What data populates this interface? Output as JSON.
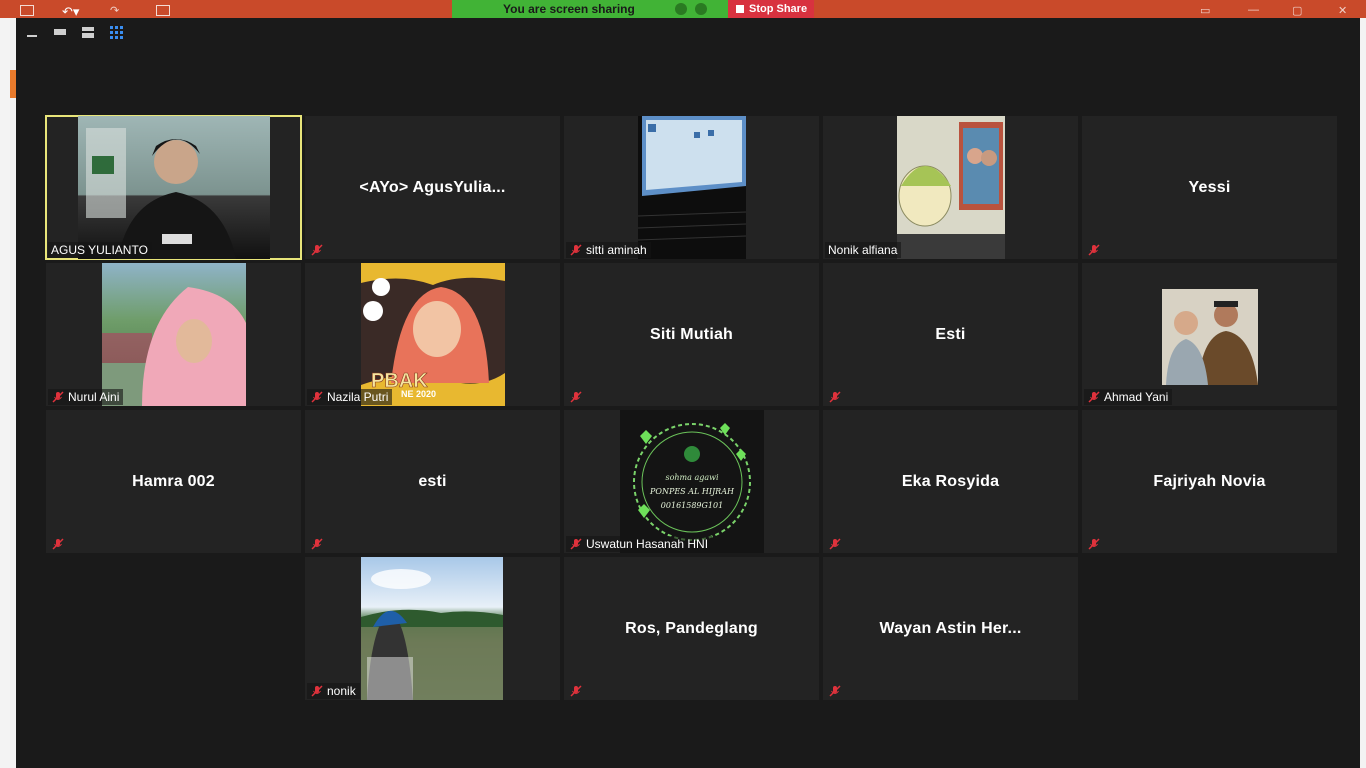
{
  "banner": {
    "text": "You are screen sharing",
    "stop_label": "Stop Share"
  },
  "colors": {
    "banner_green": "#41b336",
    "stop_red": "#d8323f",
    "active_border": "#e8e57a",
    "muted_mic": "#e0323c"
  },
  "participants": [
    {
      "name": "AGUS YULIANTO",
      "center_name": "",
      "video": true,
      "active": true,
      "muted": false
    },
    {
      "name": "",
      "center_name": "<AYo> AgusYulia...",
      "video": false,
      "active": false,
      "muted": true
    },
    {
      "name": "sitti aminah",
      "center_name": "",
      "video": true,
      "active": false,
      "muted": true
    },
    {
      "name": "Nonik alfiana",
      "center_name": "",
      "video": true,
      "active": false,
      "muted": false
    },
    {
      "name": "",
      "center_name": "Yessi",
      "video": false,
      "active": false,
      "muted": true
    },
    {
      "name": "Nurul Aini",
      "center_name": "",
      "video": true,
      "active": false,
      "muted": true
    },
    {
      "name": "Nazila Putri",
      "center_name": "",
      "video": true,
      "active": false,
      "muted": true
    },
    {
      "name": "",
      "center_name": "Siti Mutiah",
      "video": false,
      "active": false,
      "muted": true
    },
    {
      "name": "",
      "center_name": "Esti",
      "video": false,
      "active": false,
      "muted": true
    },
    {
      "name": "Ahmad Yani",
      "center_name": "",
      "video": true,
      "active": false,
      "muted": true
    },
    {
      "name": "",
      "center_name": "Hamra 002",
      "video": false,
      "active": false,
      "muted": true
    },
    {
      "name": "",
      "center_name": "esti",
      "video": false,
      "active": false,
      "muted": true
    },
    {
      "name": "Uswatun Hasanah HNI",
      "center_name": "",
      "video": true,
      "active": false,
      "muted": true
    },
    {
      "name": "",
      "center_name": "Eka Rosyida",
      "video": false,
      "active": false,
      "muted": true
    },
    {
      "name": "",
      "center_name": "Fajriyah Novia",
      "video": false,
      "active": false,
      "muted": true
    },
    {
      "name": "nonik",
      "center_name": "",
      "video": true,
      "active": false,
      "muted": true
    },
    {
      "name": "",
      "center_name": "Ros, Pandeglang",
      "video": false,
      "active": false,
      "muted": true
    },
    {
      "name": "",
      "center_name": "Wayan Astin Her...",
      "video": false,
      "active": false,
      "muted": true
    }
  ],
  "video_icons": [
    "person-video",
    "screen-video",
    "drawing-video",
    "person-video",
    "poster-image",
    "family-photo",
    "logo-image",
    "landscape-photo"
  ],
  "pbak_poster": {
    "text": "PBAK",
    "year": "NE 2020"
  },
  "hijrah_logo": {
    "line1": "sohma agawi",
    "line2": "PONPES AL HIJRAH",
    "line3": "00161589G101"
  }
}
